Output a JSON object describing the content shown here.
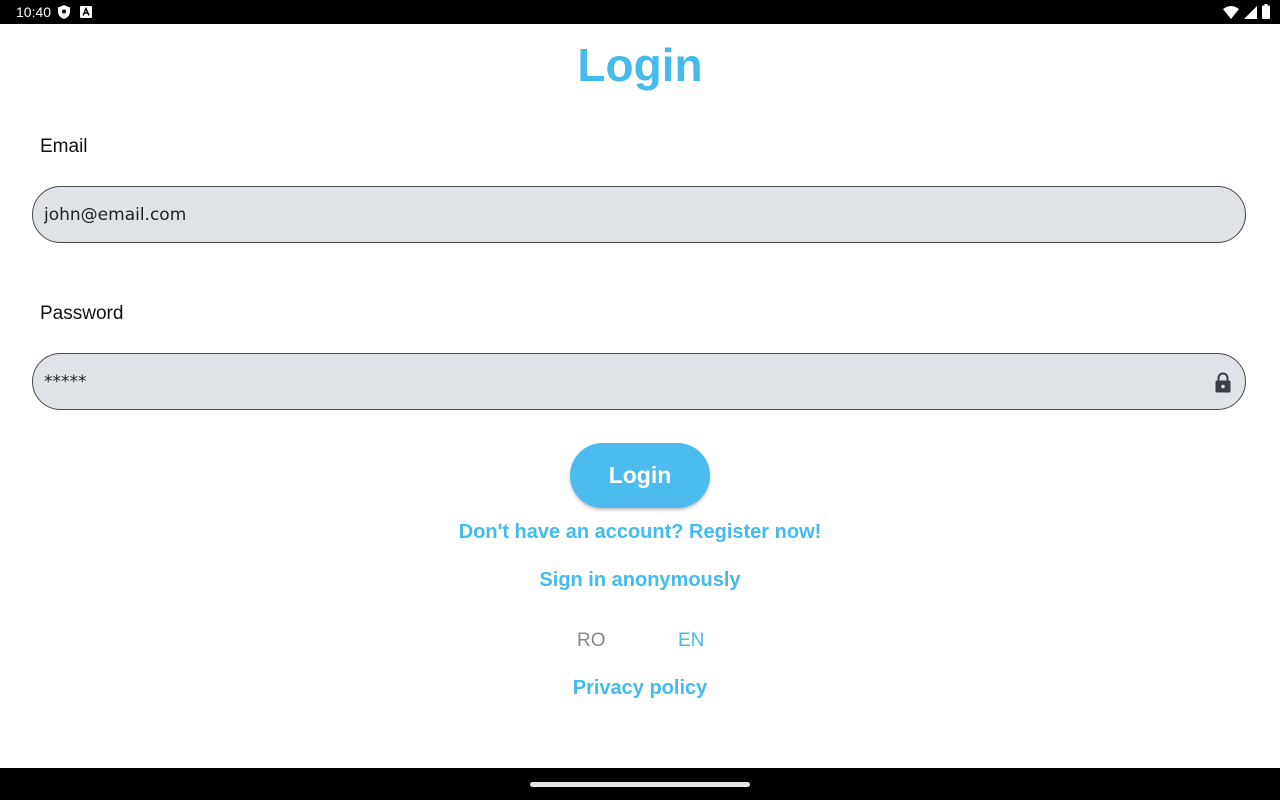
{
  "status_bar": {
    "time": "10:40"
  },
  "page": {
    "title": "Login"
  },
  "form": {
    "email_label": "Email",
    "email_value": "john@email.com",
    "password_label": "Password",
    "password_value": "*****",
    "login_button": "Login"
  },
  "links": {
    "register": "Don't have an account? Register now!",
    "anonymous": "Sign in anonymously",
    "privacy": "Privacy policy"
  },
  "language": {
    "options": [
      "RO",
      "EN"
    ],
    "selected": "EN"
  },
  "colors": {
    "accent": "#44bbee",
    "input_background": "#dfe2e7",
    "inactive_language": "#888888"
  },
  "icons": {
    "status_left": [
      "shield-icon",
      "autofill-icon"
    ],
    "status_right": [
      "wifi-icon",
      "signal-icon",
      "battery-icon"
    ],
    "password_field": "lock-icon"
  }
}
